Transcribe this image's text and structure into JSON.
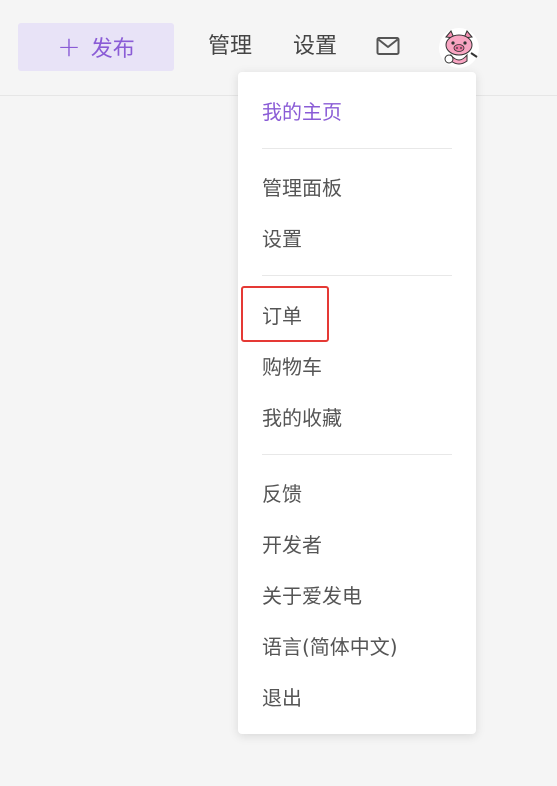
{
  "header": {
    "publish_label": "发布",
    "publish_icon": "plus-icon",
    "manage_label": "管理",
    "settings_label": "设置",
    "mail_icon": "mail-icon",
    "avatar_icon": "pig-avatar"
  },
  "menu": {
    "items": [
      {
        "label": "我的主页"
      },
      {
        "label": "管理面板"
      },
      {
        "label": "设置"
      },
      {
        "label": "订单"
      },
      {
        "label": "购物车"
      },
      {
        "label": "我的收藏"
      },
      {
        "label": "反馈"
      },
      {
        "label": "开发者"
      },
      {
        "label": "关于爱发电"
      },
      {
        "label": "语言(简体中文)"
      },
      {
        "label": "退出"
      }
    ]
  },
  "colors": {
    "accent": "#8a5cd6",
    "highlight_border": "#e53935",
    "publish_bg": "#e8e3f7"
  }
}
